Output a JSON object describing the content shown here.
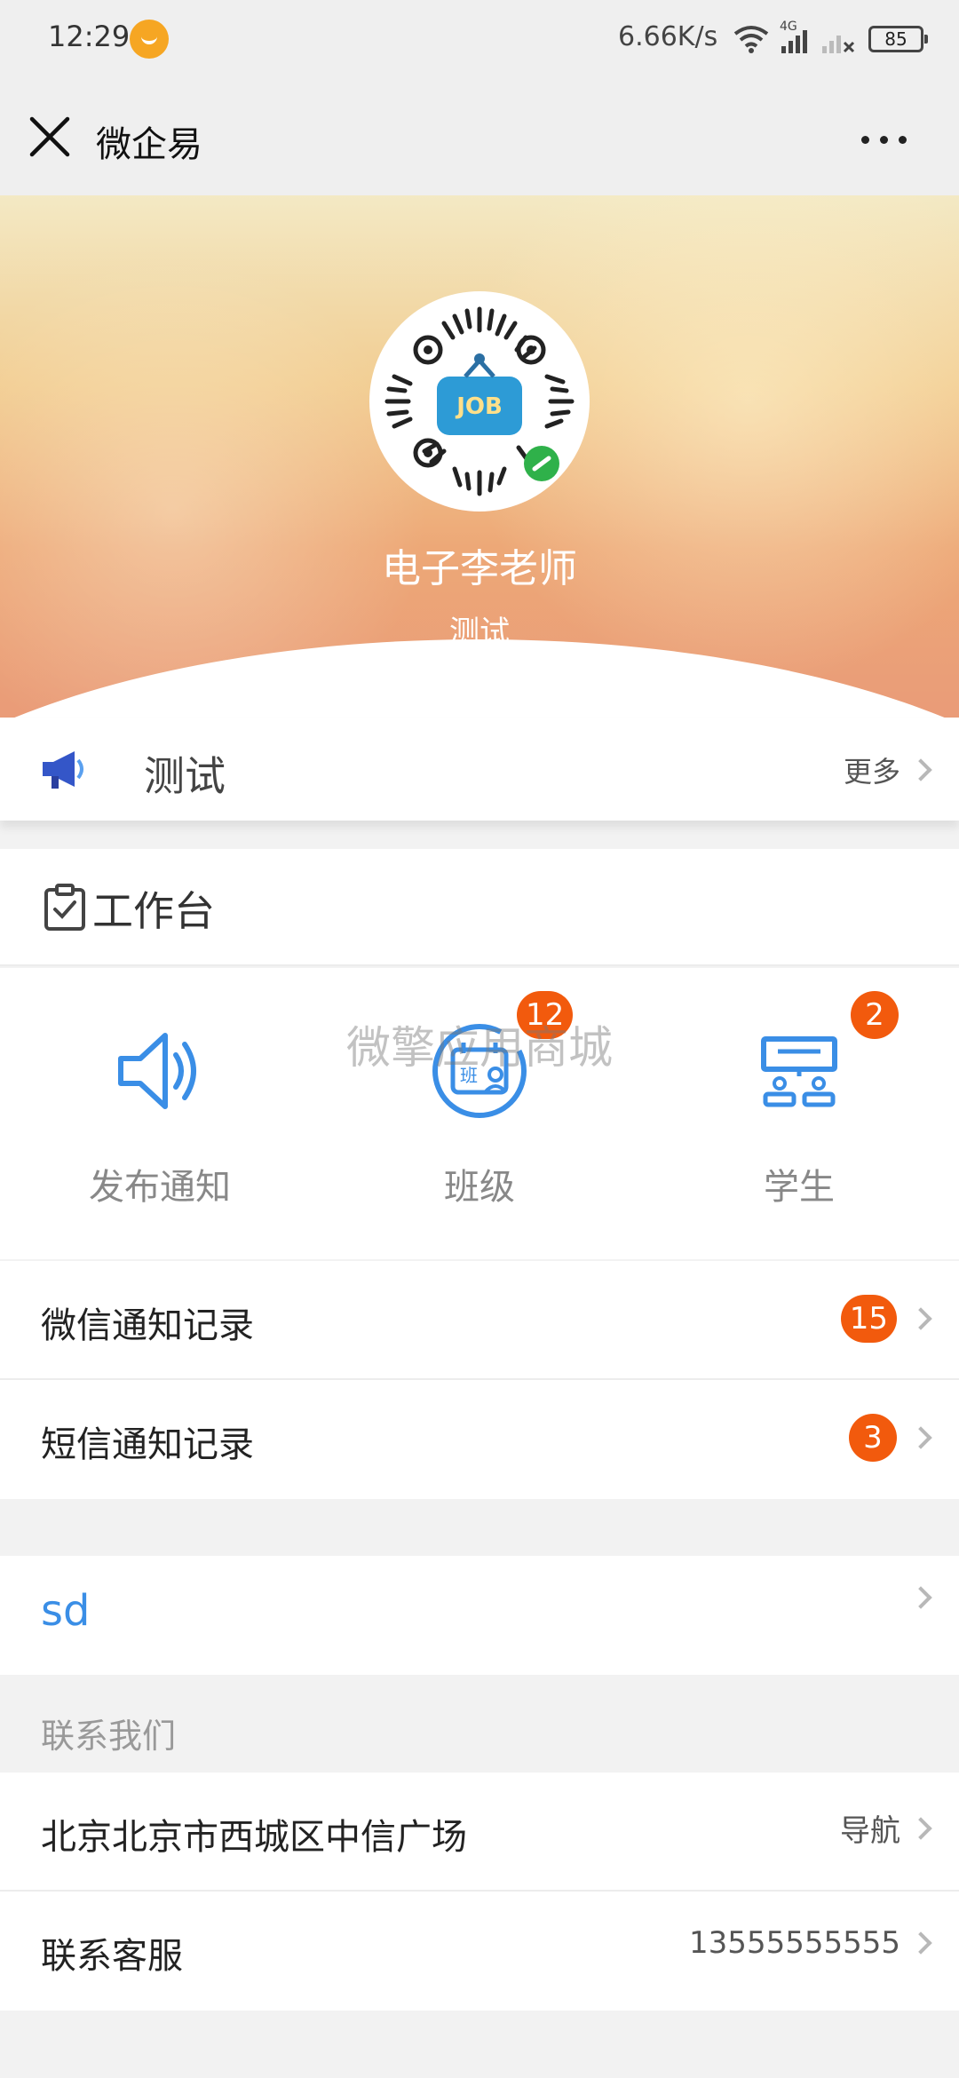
{
  "status_bar": {
    "time": "12:29",
    "speed": "6.66K/s",
    "network_label": "4G",
    "battery": "85"
  },
  "title_bar": {
    "title": "微企易"
  },
  "hero": {
    "qr_center_text": "JOB",
    "name": "电子李老师",
    "subtitle": "测试"
  },
  "notice": {
    "text": "测试",
    "more_label": "更多"
  },
  "workbench": {
    "title": "工作台",
    "items": [
      {
        "label": "发布通知",
        "badge": ""
      },
      {
        "label": "班级",
        "badge": "12",
        "icon_text": "班"
      },
      {
        "label": "学生",
        "badge": "2"
      }
    ],
    "watermark": "微擎应用商城"
  },
  "records": [
    {
      "label": "微信通知记录",
      "badge": "15"
    },
    {
      "label": "短信通知记录",
      "badge": "3"
    }
  ],
  "link_row": {
    "label": "sd"
  },
  "contact": {
    "section_title": "联系我们",
    "address": "北京北京市西城区中信广场",
    "nav_label": "导航",
    "service_label": "联系客服",
    "phone": "13555555555"
  },
  "colors": {
    "accent_blue": "#3a8ee6",
    "badge_orange": "#f25a0d"
  }
}
